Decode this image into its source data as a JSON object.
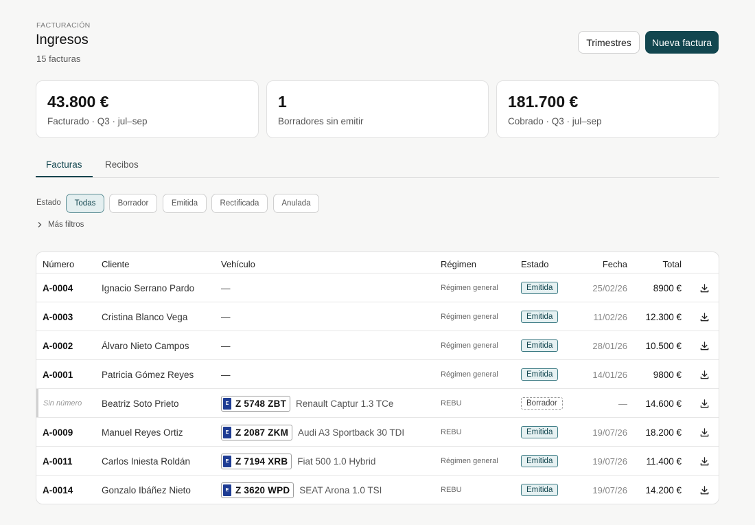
{
  "header": {
    "eyebrow": "FACTURACIÓN",
    "title": "Ingresos",
    "subtitle": "15 facturas",
    "btn_trimestres": "Trimestres",
    "btn_nueva": "Nueva factura"
  },
  "kpis": [
    {
      "value": "43.800 €",
      "label": "Facturado · Q3 · jul–sep"
    },
    {
      "value": "1",
      "label": "Borradores sin emitir"
    },
    {
      "value": "181.700 €",
      "label": "Cobrado · Q3 · jul–sep"
    }
  ],
  "tabs": [
    {
      "label": "Facturas",
      "active": true
    },
    {
      "label": "Recibos",
      "active": false
    }
  ],
  "filters": {
    "label": "Estado",
    "chips": [
      "Todas",
      "Borrador",
      "Emitida",
      "Rectificada",
      "Anulada"
    ],
    "selected": "Todas",
    "more": "Más filtros"
  },
  "table": {
    "columns": [
      "Número",
      "Cliente",
      "Vehículo",
      "Régimen",
      "Estado",
      "Fecha",
      "Total"
    ],
    "rows": [
      {
        "numero": "A-0004",
        "cliente": "Ignacio Serrano Pardo",
        "placa": "",
        "modelo": "—",
        "regimen": "Régimen general",
        "estado": "Emitida",
        "fecha": "25/02/26",
        "total": "8900 €"
      },
      {
        "numero": "A-0003",
        "cliente": "Cristina Blanco Vega",
        "placa": "",
        "modelo": "—",
        "regimen": "Régimen general",
        "estado": "Emitida",
        "fecha": "11/02/26",
        "total": "12.300 €"
      },
      {
        "numero": "A-0002",
        "cliente": "Álvaro Nieto Campos",
        "placa": "",
        "modelo": "—",
        "regimen": "Régimen general",
        "estado": "Emitida",
        "fecha": "28/01/26",
        "total": "10.500 €"
      },
      {
        "numero": "A-0001",
        "cliente": "Patricia Gómez Reyes",
        "placa": "",
        "modelo": "—",
        "regimen": "Régimen general",
        "estado": "Emitida",
        "fecha": "14/01/26",
        "total": "9800 €"
      },
      {
        "numero": "Sin número",
        "cliente": "Beatriz Soto Prieto",
        "placa": "Z 5748 ZBT",
        "modelo": "Renault Captur 1.3 TCe",
        "regimen": "REBU",
        "estado": "Borrador",
        "fecha": "—",
        "total": "14.600 €"
      },
      {
        "numero": "A-0009",
        "cliente": "Manuel Reyes Ortiz",
        "placa": "Z 2087 ZKM",
        "modelo": "Audi A3 Sportback 30 TDI",
        "regimen": "REBU",
        "estado": "Emitida",
        "fecha": "19/07/26",
        "total": "18.200 €"
      },
      {
        "numero": "A-0011",
        "cliente": "Carlos Iniesta Roldán",
        "placa": "Z 7194 XRB",
        "modelo": "Fiat 500 1.0 Hybrid",
        "regimen": "Régimen general",
        "estado": "Emitida",
        "fecha": "19/07/26",
        "total": "11.400 €"
      },
      {
        "numero": "A-0014",
        "cliente": "Gonzalo Ibáñez Nieto",
        "placa": "Z 3620 WPD",
        "modelo": "SEAT Arona 1.0 TSI",
        "regimen": "REBU",
        "estado": "Emitida",
        "fecha": "19/07/26",
        "total": "14.200 €"
      }
    ]
  },
  "plate_country": "E",
  "icons": {
    "download": "download-icon",
    "chevron": "chevron-right-icon"
  },
  "colors": {
    "primary": "#12464f",
    "badge_bg": "#e6f1f2"
  }
}
